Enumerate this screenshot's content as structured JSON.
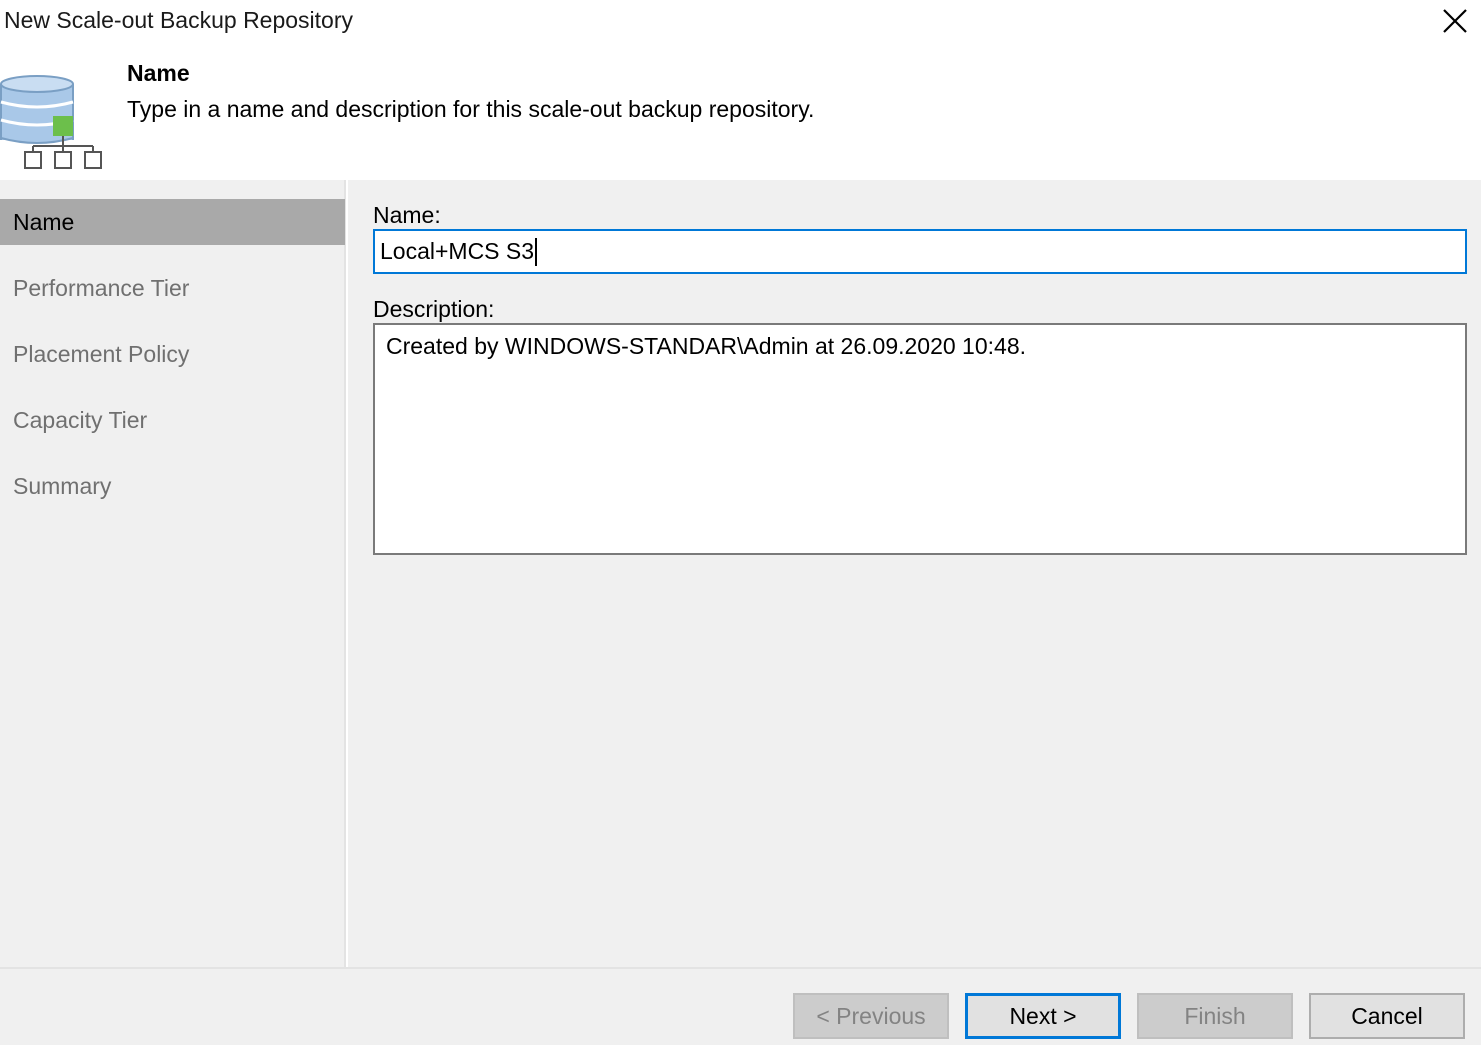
{
  "window": {
    "title": "New Scale-out Backup Repository"
  },
  "header": {
    "icon": "database-repository-icon",
    "title": "Name",
    "description": "Type in a name and description for this scale-out backup repository."
  },
  "sidebar": {
    "steps": [
      {
        "label": "Name",
        "active": true
      },
      {
        "label": "Performance Tier",
        "active": false
      },
      {
        "label": "Placement Policy",
        "active": false
      },
      {
        "label": "Capacity Tier",
        "active": false
      },
      {
        "label": "Summary",
        "active": false
      }
    ]
  },
  "form": {
    "name_label": "Name:",
    "name_value": "Local+MCS S3",
    "description_label": "Description:",
    "description_value": "Created by WINDOWS-STANDAR\\Admin at 26.09.2020 10:48."
  },
  "footer": {
    "previous_label": "< Previous",
    "next_label": "Next >",
    "finish_label": "Finish",
    "cancel_label": "Cancel"
  },
  "colors": {
    "accent": "#0078d7",
    "sidebar_active": "#a9a9a9",
    "panel_bg": "#f0f0f0",
    "icon_green": "#6cbf4b",
    "icon_blue": "#a9c8e8"
  }
}
